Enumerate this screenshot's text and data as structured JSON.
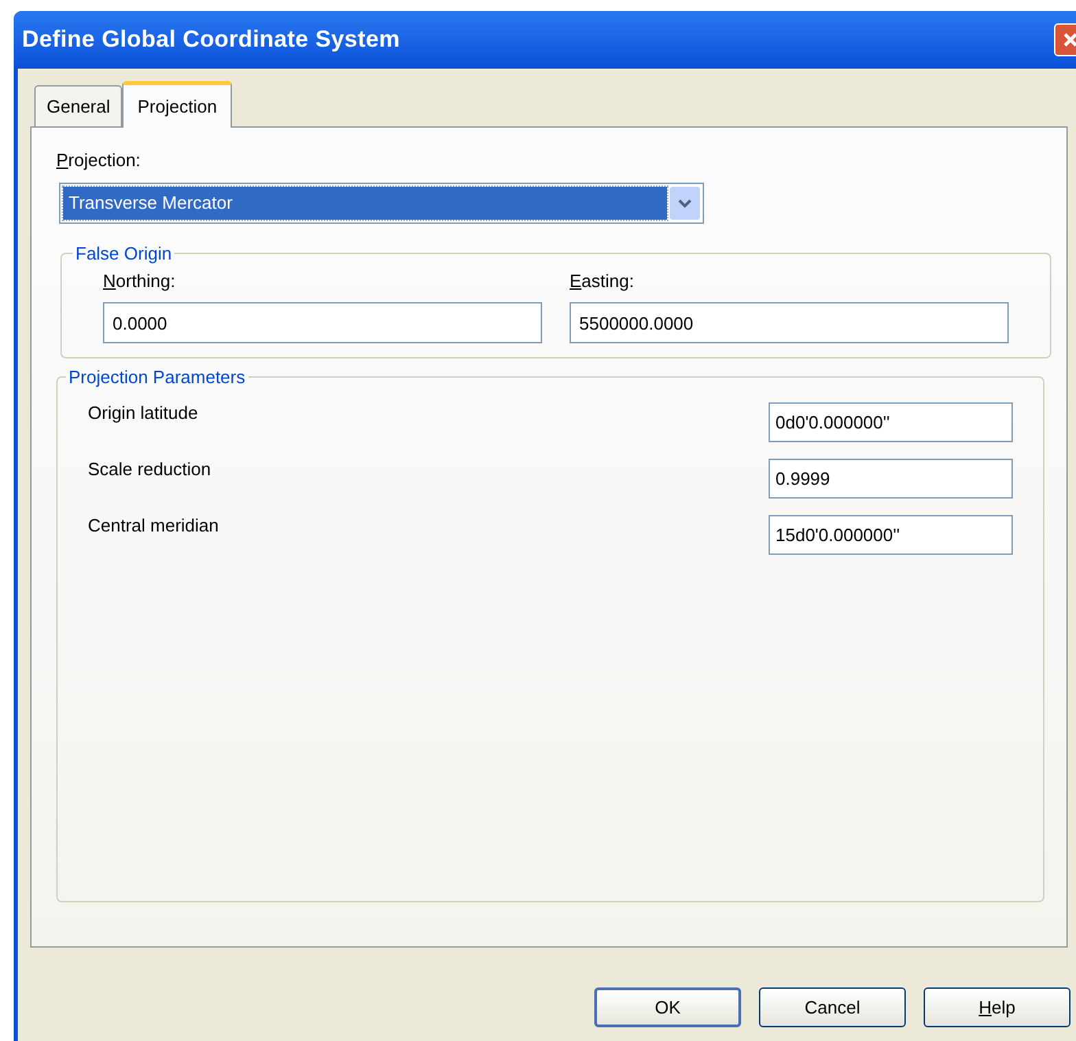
{
  "window": {
    "title": "Define Global Coordinate System"
  },
  "tabs": [
    {
      "label": "General",
      "selected": false
    },
    {
      "label": "Projection",
      "selected": true
    }
  ],
  "projection": {
    "label": "Projection:",
    "mnemonic": true,
    "value": "Transverse Mercator",
    "focused": true
  },
  "false_origin": {
    "title": "False Origin",
    "fields": [
      {
        "label": "Northing:",
        "mnemonic": true,
        "value": "0.0000"
      },
      {
        "label": "Easting:",
        "mnemonic": true,
        "value": "5500000.0000"
      }
    ]
  },
  "projection_parameters": {
    "title": "Projection Parameters",
    "rows": [
      {
        "label": "Origin latitude",
        "value": "0d0'0.000000''"
      },
      {
        "label": "Scale reduction",
        "value": "0.9999"
      },
      {
        "label": "Central meridian",
        "value": "15d0'0.000000''"
      }
    ]
  },
  "buttons": [
    {
      "label": "OK",
      "default": true,
      "mnemonic": false
    },
    {
      "label": "Cancel",
      "default": false,
      "mnemonic": false
    },
    {
      "label": "Help",
      "default": false,
      "mnemonic": true
    }
  ]
}
